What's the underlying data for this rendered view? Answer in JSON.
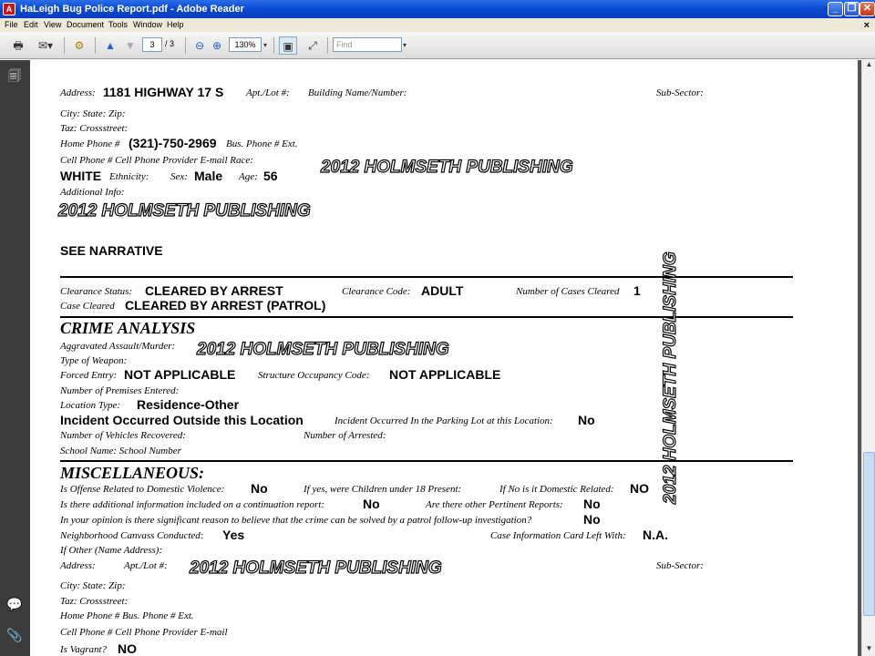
{
  "window": {
    "title": "HaLeigh Bug Police Report.pdf - Adobe Reader",
    "minimize": "_",
    "maximize": "❐",
    "close": "✕"
  },
  "menu": {
    "file": "File",
    "edit": "Edit",
    "view": "View",
    "document": "Document",
    "tools": "Tools",
    "window": "Window",
    "help": "Help",
    "close_doc": "×"
  },
  "toolbar": {
    "current_page": "3",
    "page_sep": "/",
    "total_pages": "3",
    "zoom": "130%",
    "find_placeholder": "Find"
  },
  "colors": {
    "titlebar": "#0a47d0",
    "menubar": "#ece9d8",
    "navpanel": "#3c3c3c"
  },
  "watermark": "2012 HOLMSETH PUBLISHING",
  "doc": {
    "address_label": "Address:",
    "address_value": "1181 HIGHWAY 17  S",
    "apt_label": "Apt./Lot #:",
    "building_label": "Building Name/Number:",
    "subsector_label": "Sub-Sector:",
    "city_state_zip": "City:   State:   Zip:",
    "taz_cross": "Taz:   Crossstreet:",
    "home_phone_label": "Home Phone #",
    "home_phone_value": "(321)-750-2969",
    "bus_phone_label": "Bus. Phone # Ext.",
    "cell_row": "Cell Phone #   Cell Phone Provider   E-mail     Race:",
    "race_value": "WHITE",
    "ethnicity_label": "Ethnicity:",
    "sex_label": "Sex:",
    "sex_value": "Male",
    "age_label": "Age:",
    "age_value": "56",
    "additional_info": "Additional Info:",
    "see_narrative": "SEE NARRATIVE",
    "clearance_status_label": "Clearance Status:",
    "clearance_status_value": "CLEARED BY ARREST",
    "clearance_code_label": "Clearance Code:",
    "clearance_code_value": "ADULT",
    "cases_cleared_label": "Number of Cases Cleared",
    "cases_cleared_value": "1",
    "case_cleared_label": "Case Cleared",
    "case_cleared_value": "CLEARED BY ARREST (PATROL)",
    "crime_analysis": "CRIME ANALYSIS",
    "aggravated": "Aggravated Assault/Murder:",
    "weapon": "Type of Weapon:",
    "forced_entry_label": "Forced Entry:",
    "forced_entry_value": "NOT APPLICABLE",
    "structure_label": "Structure Occupancy Code:",
    "structure_value": "NOT APPLICABLE",
    "premises": "Number of Premises Entered:",
    "location_type_label": "Location Type:",
    "location_type_value": "Residence-Other",
    "outside_location": "Incident Occurred Outside this Location",
    "parking_label": "Incident Occurred In the Parking Lot at this Location:",
    "parking_value": "No",
    "vehicles": "Number of Vehicles Recovered:",
    "arrested": "Number of Arrested:",
    "school": "School Name:     School Number",
    "misc": "MISCELLANEOUS:",
    "dv_label": "Is Offense Related to Domestic Violence:",
    "dv_value": "No",
    "children_label": "If yes, were Children under 18 Present:",
    "domestic_label": "If No is it Domestic Related:",
    "domestic_value": "NO",
    "continuation_label": "Is there additional information included on a continuation report:",
    "continuation_value": "No",
    "pertinent_label": "Are there other Pertinent Reports:",
    "pertinent_value": "No",
    "solved_label": "In your opinion is there significant reason to believe that the crime can be solved by a patrol follow-up investigation?",
    "solved_value": "No",
    "canvass_label": "Neighborhood Canvass Conducted:",
    "canvass_value": "Yes",
    "card_label": "Case Information Card Left With:",
    "card_value": "N.A.",
    "if_other": "If Other (Name Address):",
    "address2_label": "Address:",
    "apt2_label": "Apt./Lot #:",
    "subsector2_label": "Sub-Sector:",
    "city_state_zip2": "City:   State:   Zip:",
    "taz_cross2": "Taz:   Crossstreet:",
    "home_phone2": "Home Phone #  Bus. Phone # Ext.",
    "cell_row2": "Cell Phone #    Cell Phone Provider    E-mail",
    "vagrant_label": "Is Vagrant?",
    "vagrant_value": "NO"
  }
}
